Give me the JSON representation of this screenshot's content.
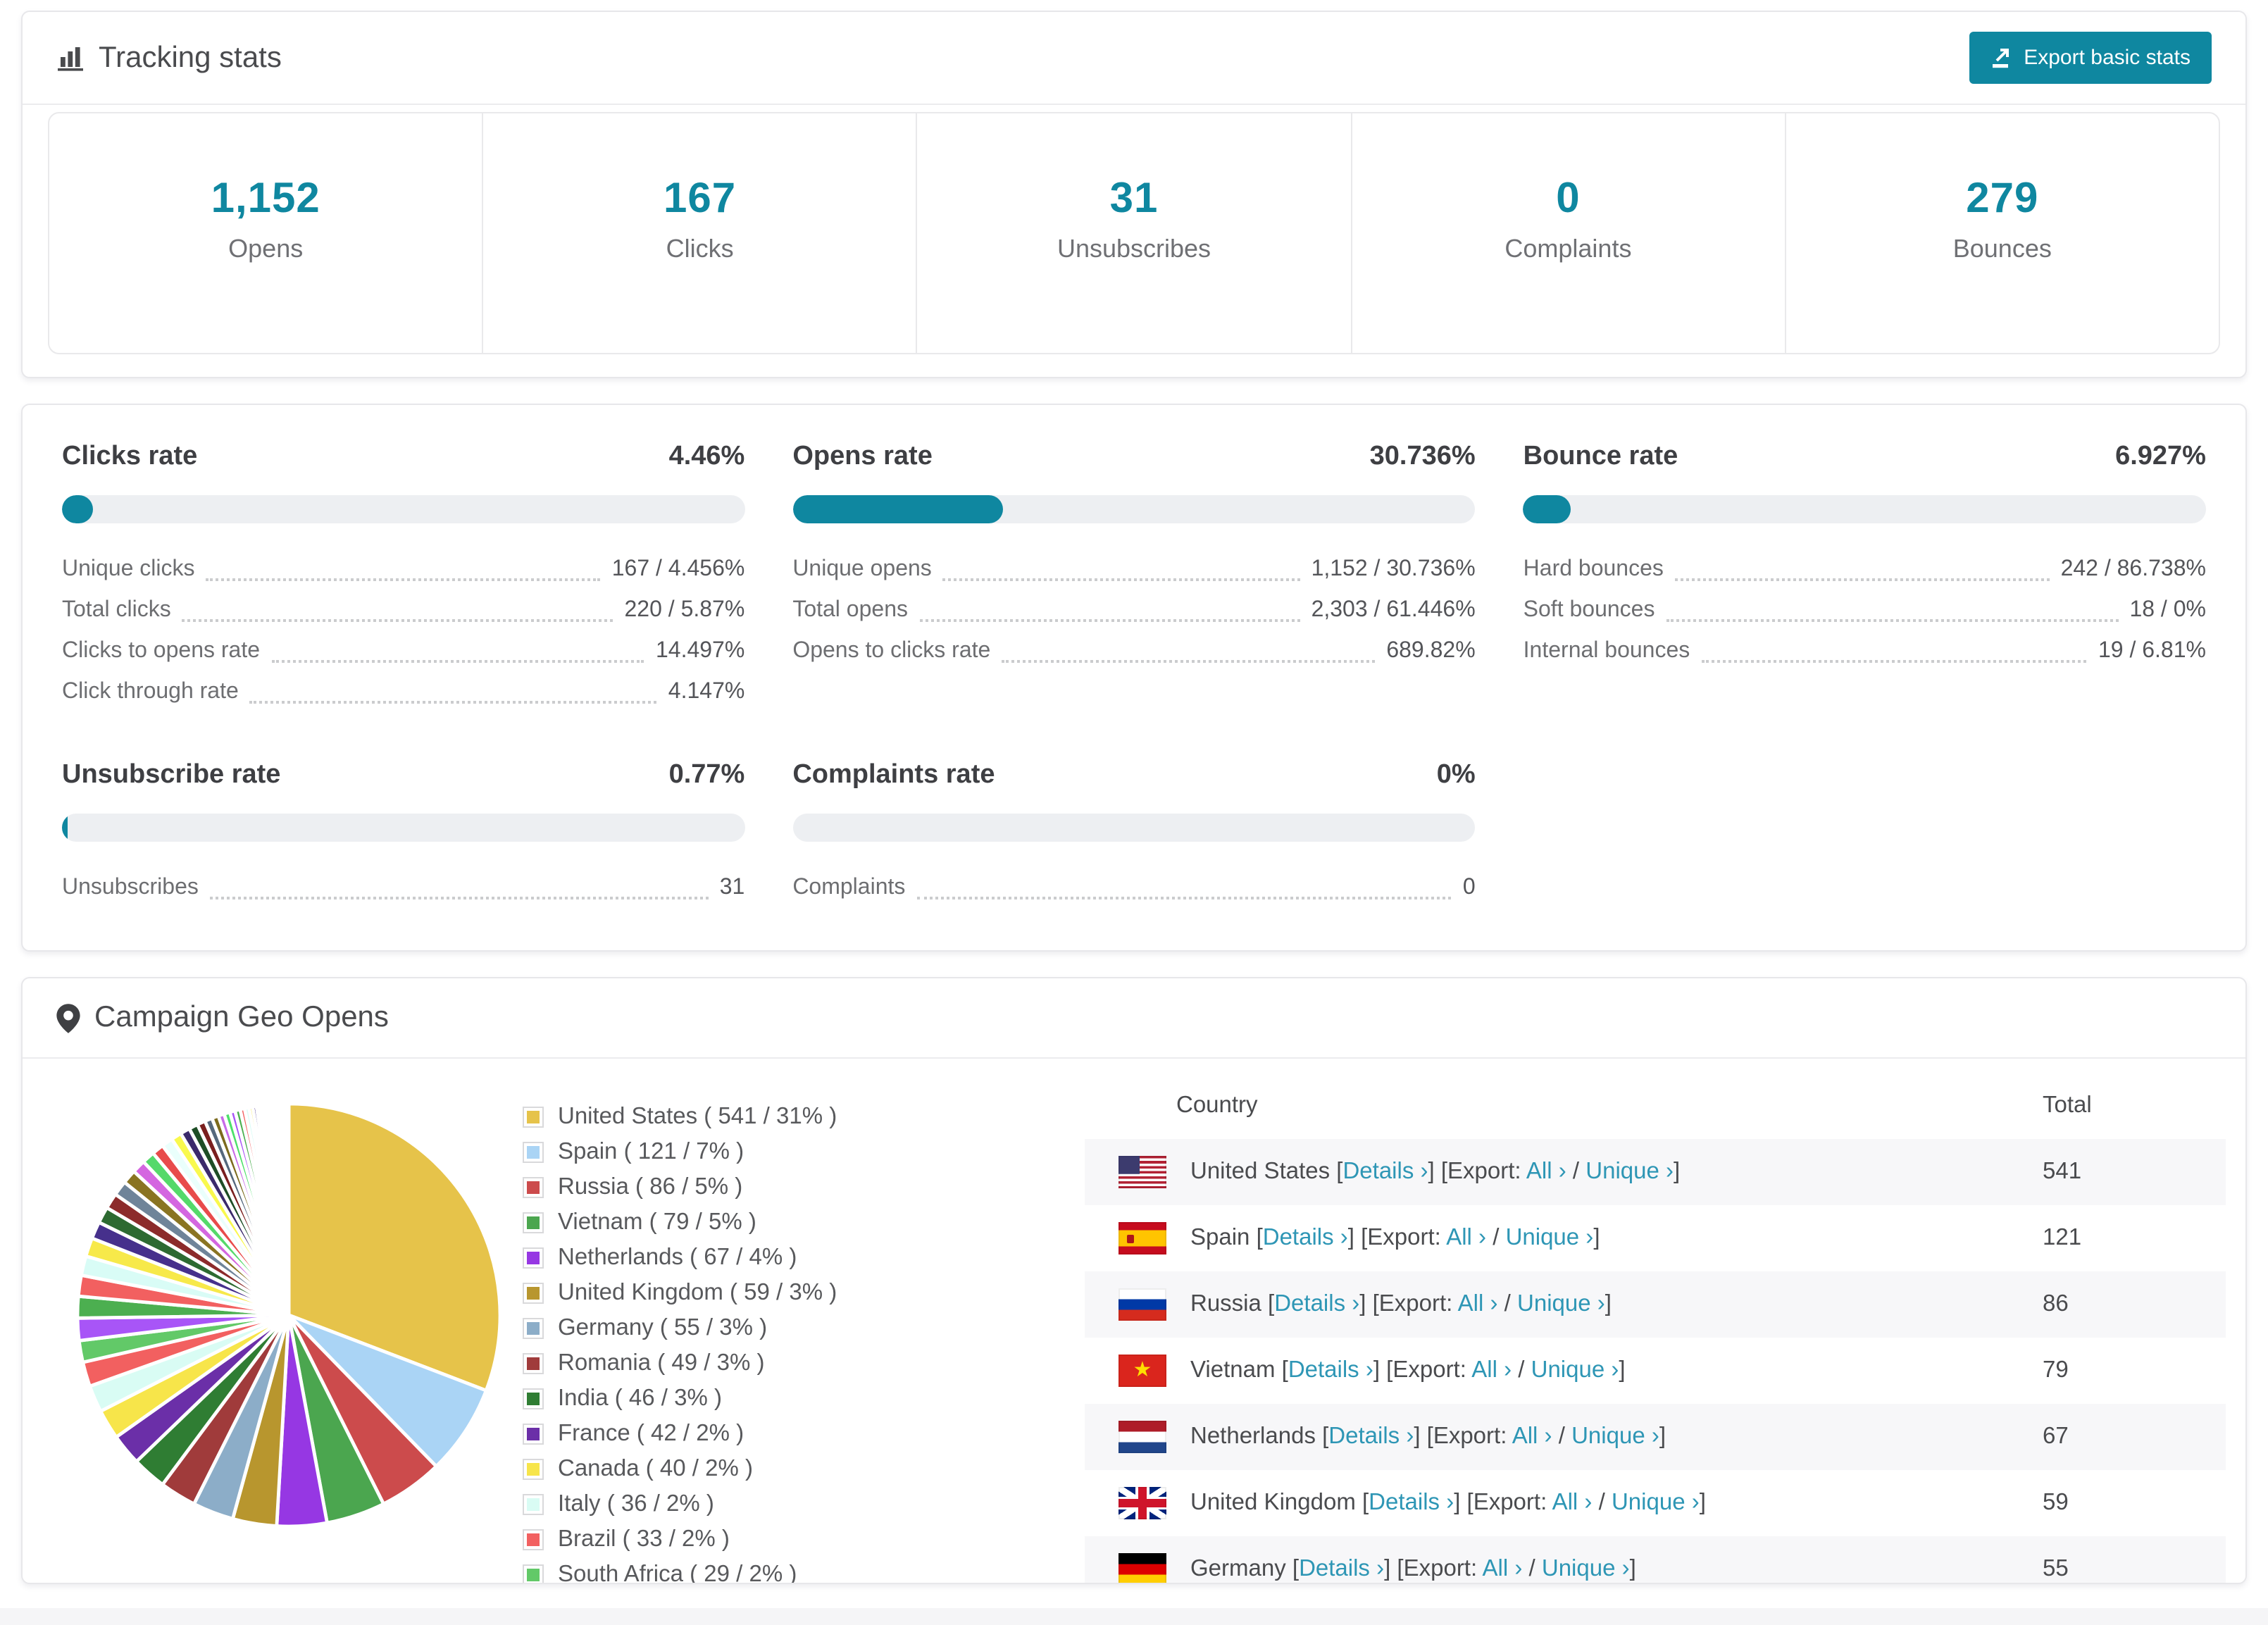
{
  "accent_color": "#0f87a0",
  "link_color": "#2e96b5",
  "tracking": {
    "title": "Tracking stats",
    "export_label": "Export basic stats",
    "stats": [
      {
        "value": "1,152",
        "label": "Opens"
      },
      {
        "value": "167",
        "label": "Clicks"
      },
      {
        "value": "31",
        "label": "Unsubscribes"
      },
      {
        "value": "0",
        "label": "Complaints"
      },
      {
        "value": "279",
        "label": "Bounces"
      }
    ]
  },
  "rates": [
    {
      "title": "Clicks rate",
      "percent": "4.46%",
      "bar_pct": 4.46,
      "rows": [
        {
          "label": "Unique clicks",
          "value": "167 / 4.456%"
        },
        {
          "label": "Total clicks",
          "value": "220 / 5.87%"
        },
        {
          "label": "Clicks to opens rate",
          "value": "14.497%"
        },
        {
          "label": "Click through rate",
          "value": "4.147%"
        }
      ]
    },
    {
      "title": "Opens rate",
      "percent": "30.736%",
      "bar_pct": 30.736,
      "rows": [
        {
          "label": "Unique opens",
          "value": "1,152 / 30.736%"
        },
        {
          "label": "Total opens",
          "value": "2,303 / 61.446%"
        },
        {
          "label": "Opens to clicks rate",
          "value": "689.82%"
        }
      ]
    },
    {
      "title": "Bounce rate",
      "percent": "6.927%",
      "bar_pct": 6.927,
      "rows": [
        {
          "label": "Hard bounces",
          "value": "242 / 86.738%"
        },
        {
          "label": "Soft bounces",
          "value": "18 / 0%"
        },
        {
          "label": "Internal bounces",
          "value": "19 / 6.81%"
        }
      ]
    },
    {
      "title": "Unsubscribe rate",
      "percent": "0.77%",
      "bar_pct": 0.77,
      "rows": [
        {
          "label": "Unsubscribes",
          "value": "31"
        }
      ]
    },
    {
      "title": "Complaints rate",
      "percent": "0%",
      "bar_pct": 0,
      "rows": [
        {
          "label": "Complaints",
          "value": "0"
        }
      ]
    }
  ],
  "geo": {
    "title": "Campaign Geo Opens",
    "table_columns": {
      "country": "Country",
      "total": "Total"
    },
    "row_links": {
      "details": "Details ›",
      "export_prefix": "Export:",
      "all": "All ›",
      "sep": "/",
      "unique": "Unique ›"
    },
    "rows": [
      {
        "country": "United States",
        "flag": "us",
        "total": "541"
      },
      {
        "country": "Spain",
        "flag": "es",
        "total": "121"
      },
      {
        "country": "Russia",
        "flag": "ru",
        "total": "86"
      },
      {
        "country": "Vietnam",
        "flag": "vn",
        "total": "79"
      },
      {
        "country": "Netherlands",
        "flag": "nl",
        "total": "67"
      },
      {
        "country": "United Kingdom",
        "flag": "gb",
        "total": "59"
      },
      {
        "country": "Germany",
        "flag": "de",
        "total": "55"
      }
    ]
  },
  "chart_data": {
    "type": "pie",
    "title": "Campaign Geo Opens",
    "legend_position": "right",
    "categories": [
      "United States",
      "Spain",
      "Russia",
      "Vietnam",
      "Netherlands",
      "United Kingdom",
      "Germany",
      "Romania",
      "India",
      "France",
      "Canada",
      "Italy",
      "Brazil",
      "South Africa"
    ],
    "values": [
      541,
      121,
      86,
      79,
      67,
      59,
      55,
      49,
      46,
      42,
      40,
      36,
      33,
      29
    ],
    "percent_labels": [
      "31%",
      "7%",
      "5%",
      "5%",
      "4%",
      "3%",
      "3%",
      "3%",
      "3%",
      "2%",
      "2%",
      "2%",
      "2%",
      "2%"
    ],
    "colors": [
      "#e6c34a",
      "#aad4f5",
      "#cc4b4c",
      "#4ba64f",
      "#9637e3",
      "#b8962e",
      "#8cadc8",
      "#a03b3b",
      "#2f7d33",
      "#6b2fa8",
      "#f7e54a",
      "#d9fcf4",
      "#f26060",
      "#62c968"
    ],
    "unlabeled_other_slices": [
      30,
      29,
      28,
      26,
      25,
      23,
      22,
      21,
      20,
      19,
      18,
      17,
      16,
      15,
      14,
      13,
      12,
      11,
      10,
      9,
      8,
      8,
      7,
      7,
      6,
      6,
      5,
      5,
      4,
      4,
      4,
      3,
      3,
      3,
      2,
      2,
      2,
      2,
      2,
      1,
      1,
      1,
      1,
      1,
      1,
      1,
      1,
      1,
      1,
      1,
      1
    ],
    "other_slice_palette": [
      "#a855f7",
      "#4caf50",
      "#f26060",
      "#d9fcf6",
      "#f7e94a",
      "#46308c",
      "#2d6a31",
      "#8c2b2b",
      "#6f8499",
      "#8a7422",
      "#d466e0",
      "#55d96a",
      "#e84b4b",
      "#eafffc",
      "#f9f94d",
      "#3b2a6b",
      "#1e4d26",
      "#7a1f1f",
      "#55687d",
      "#7c6a1d",
      "#c76ae8",
      "#4ce06a"
    ]
  }
}
